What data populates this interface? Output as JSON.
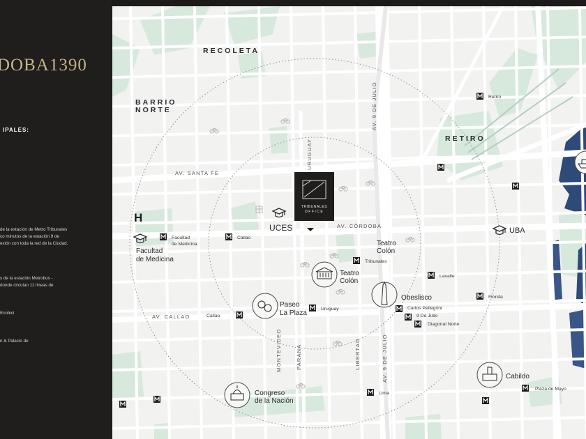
{
  "sidebar": {
    "title": "DOBA1390",
    "heading": "IPALES:",
    "items": [
      "de la estación de Metro Tribunales\nco minutos de la estación 9 de\nexión con toda la red de la Ciudad.",
      "s de la estación Metrobus -\ndonde circulan 11 líneas de",
      "Ecobici",
      "n & Palacio de"
    ]
  },
  "map": {
    "center_logo": {
      "line1": "TRIBUNALES",
      "line2": "OFFICE"
    },
    "neighborhoods": {
      "recoleta": "RECOLETA",
      "barrio_norte_1": "BARRIO",
      "barrio_norte_2": "NORTE",
      "retiro": "RETIRO"
    },
    "streets": {
      "av_santa_fe": "AV. SANTA FE",
      "av_cordoba": "AV. CÓRDOBA",
      "av_callao": "AV. CALLAO",
      "uruguay": "URUGUAY",
      "av_9_de_julio_top": "AV. 9 DE JULIO",
      "av_9_de_julio_bottom": "AV. 9 DE JULIO",
      "montevideo": "MONTEVIDEO",
      "parana": "PARANA",
      "libertad": "LIBERTAD"
    },
    "landmarks": {
      "uces": "UCES",
      "uba": "UBA",
      "facultad_1": "Facultad",
      "facultad_2": "de Medicina",
      "teatro_colon_label_1": "Teatro",
      "teatro_colon_label_2": "Colón",
      "teatro_colon_icon_1": "Teatro",
      "teatro_colon_icon_2": "Colón",
      "obelisco": "Obeslisco",
      "paseo_1": "Paseo",
      "paseo_2": "La Plaza",
      "congreso_1": "Congreso",
      "congreso_2": "de la Nación",
      "cabildo": "Cabildo",
      "hospital": "H"
    },
    "metro_stations": {
      "retiro": "Retiro",
      "facultad_medicina_1": "Facultad",
      "facultad_medicina_2": "de Medicina",
      "callao_1": "Callao",
      "tribunales": "Tribunales",
      "lavalle": "Lavalle",
      "florida": "Florida",
      "uruguay": "Uruguay",
      "carlos_pellegrini": "Carlos Pellegrini",
      "nueve_de_julio": "9 De Julio",
      "diagonal_norte": "Diagonal Norte",
      "callao_2": "Callao",
      "lima": "Lima",
      "plaza_de_mayo": "Plaza de Mayo"
    },
    "metro_symbol": "M",
    "colors": {
      "land": "#f2f2f1",
      "park": "#d7e8dc",
      "water": "#2e4a78",
      "street_major": "#ffffff",
      "label": "#3a3a3a",
      "sidebar_bg": "#1f1e1c",
      "accent_gold": "#c9b28a"
    },
    "icons": [
      "bicycle-icon",
      "metro-icon",
      "graduation-cap-icon",
      "theater-icon",
      "obelisk-icon",
      "cruise-ship-icon"
    ]
  }
}
